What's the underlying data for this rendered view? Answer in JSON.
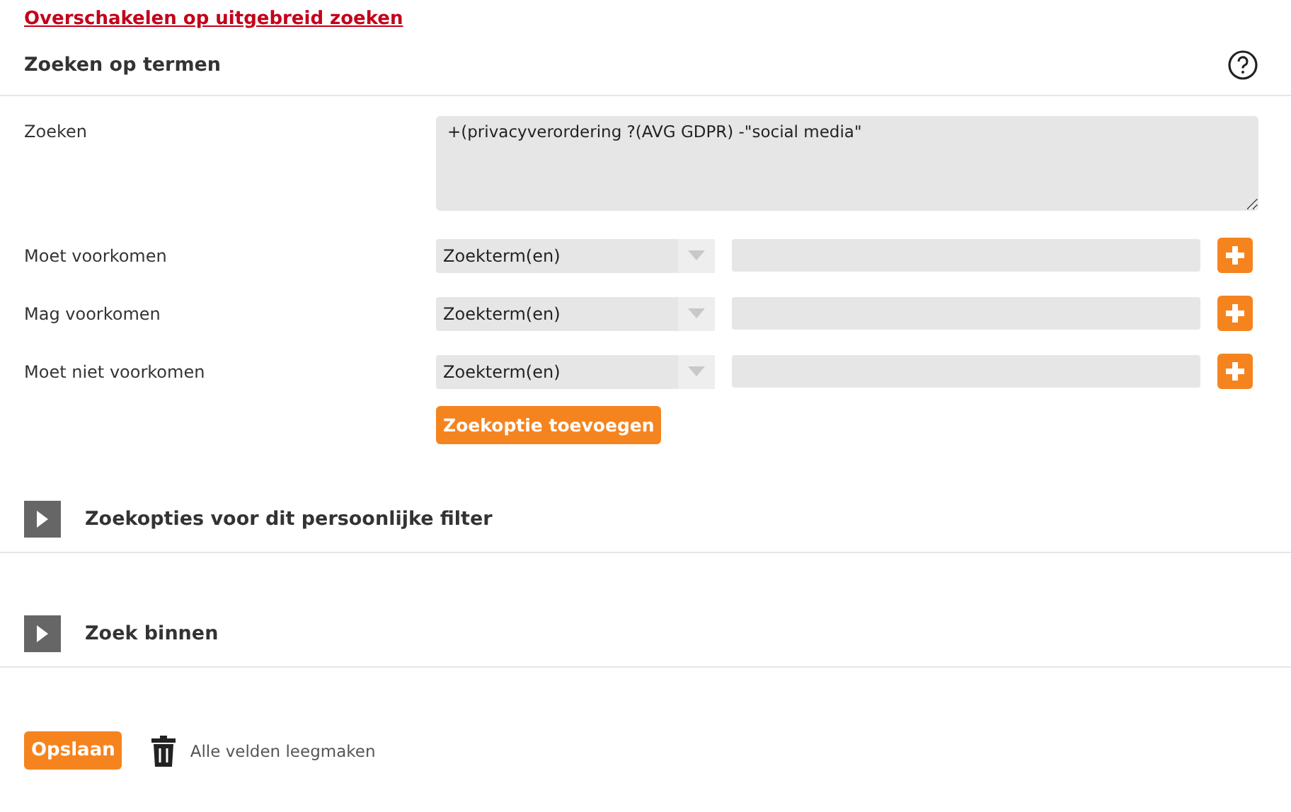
{
  "advanced_link": "Overschakelen op uitgebreid zoeken",
  "section": {
    "title": "Zoeken op termen"
  },
  "search": {
    "label": "Zoeken",
    "value": "+(privacyverordering ?(AVG GDPR) -\"social media\""
  },
  "rows": [
    {
      "label": "Moet voorkomen",
      "select": "Zoekterm(en)"
    },
    {
      "label": "Mag voorkomen",
      "select": "Zoekterm(en)"
    },
    {
      "label": "Moet niet voorkomen",
      "select": "Zoekterm(en)"
    }
  ],
  "add_button": "Zoekoptie toevoegen",
  "panels": [
    {
      "title": "Zoekopties voor dit persoonlijke filter",
      "expanded": false
    },
    {
      "title": "Zoek binnen",
      "expanded": false
    }
  ],
  "save_button": "Opslaan",
  "clear_link": "Alle velden leegmaken"
}
